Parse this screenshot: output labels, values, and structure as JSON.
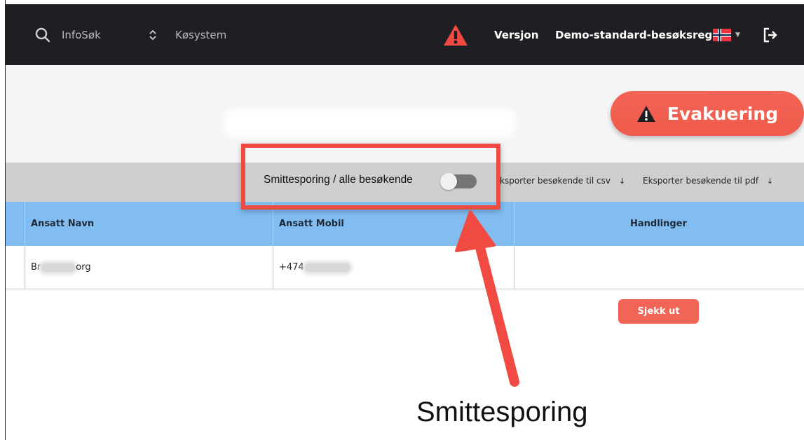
{
  "colors": {
    "topbar": "#1f1f23",
    "accent": "#f26455",
    "header_blue": "#82bdf1",
    "toolbar_gray": "#cfcfd1",
    "highlight_red": "#f04a43"
  },
  "topbar": {
    "search": {
      "icon": "search-icon",
      "label": "InfoSøk"
    },
    "queue": {
      "icon": "updown-icon",
      "label": "Køsystem"
    },
    "warning_icon": "warning-icon",
    "version_label": "Versjon",
    "demo_label": "Demo-standard-besøksreg",
    "flag_icon": "norway-flag-icon",
    "logout_icon": "logout-icon"
  },
  "hero": {
    "evacuation_button": {
      "icon": "warning-icon",
      "label": "Evakuering"
    }
  },
  "toolbar": {
    "toggle_label": "Smittesporing / alle besøkende",
    "toggle_on": false,
    "export_csv_label": "ksporter besøkende til csv",
    "export_pdf_label": "Eksporter besøkende til pdf",
    "download_icon": "↓"
  },
  "table": {
    "headers": [
      "Ansatt Navn",
      "Ansatt Mobil",
      "Handlinger"
    ],
    "rows": [
      {
        "name_start": "Br",
        "name_end": "org",
        "mobile_start": "+474",
        "action_label": "Sjekk ut"
      }
    ]
  },
  "annotation": {
    "caption": "Smittesporing"
  }
}
